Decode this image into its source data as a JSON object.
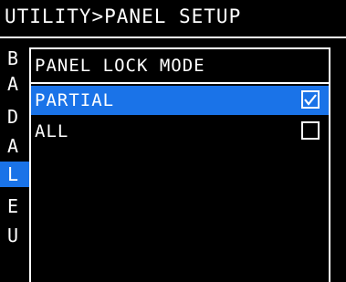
{
  "header": {
    "title": "UTILITY>PANEL SETUP"
  },
  "background_menu": {
    "items": [
      {
        "label": "B"
      },
      {
        "label": "A"
      },
      {
        "label": "D"
      },
      {
        "label": "A"
      },
      {
        "label": "L",
        "selected": true
      },
      {
        "label": "E"
      },
      {
        "label": "U"
      }
    ]
  },
  "dialog": {
    "title": "PANEL LOCK MODE",
    "options": [
      {
        "label": "PARTIAL",
        "checked": true,
        "highlighted": true
      },
      {
        "label": "ALL",
        "checked": false,
        "highlighted": false
      }
    ]
  },
  "colors": {
    "background": "#000000",
    "foreground": "#ffffff",
    "highlight": "#1a73e8"
  }
}
